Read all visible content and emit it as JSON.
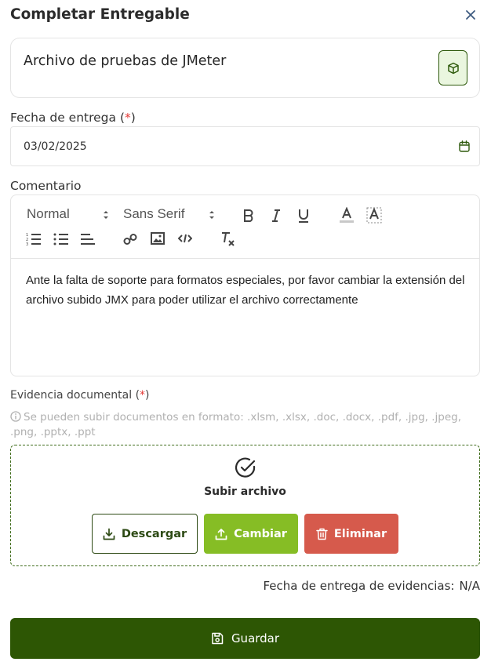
{
  "dialog": {
    "title": "Completar Entregable"
  },
  "deliverable": {
    "name": "Archivo de pruebas de JMeter"
  },
  "due_date": {
    "label": "Fecha de entrega",
    "required_mark": "*",
    "value": "03/02/2025"
  },
  "comment": {
    "label": "Comentario",
    "toolbar": {
      "header_select": "Normal",
      "font_select": "Sans Serif"
    },
    "text": "Ante la falta de soporte para formatos especiales, por favor cambiar la extensión del archivo subido JMX para poder utilizar el archivo correctamente"
  },
  "evidence": {
    "label": "Evidencia documental",
    "required_mark": "*",
    "hint": "Se pueden subir documentos en formato: .xlsm, .xlsx, .doc, .docx, .pdf, .jpg, .jpeg, .png, .pptx, .ppt",
    "upload_text": "Subir archivo",
    "buttons": {
      "download": "Descargar",
      "change": "Cambiar",
      "delete": "Eliminar"
    },
    "delivery_date_label": "Fecha de entrega de evidencias:",
    "delivery_date_value": "N/A"
  },
  "actions": {
    "save": "Guardar"
  },
  "colors": {
    "primary_dark": "#2d5604",
    "change_green": "#86bd25",
    "delete_red": "#d65a4c",
    "required_red": "#e53935"
  }
}
